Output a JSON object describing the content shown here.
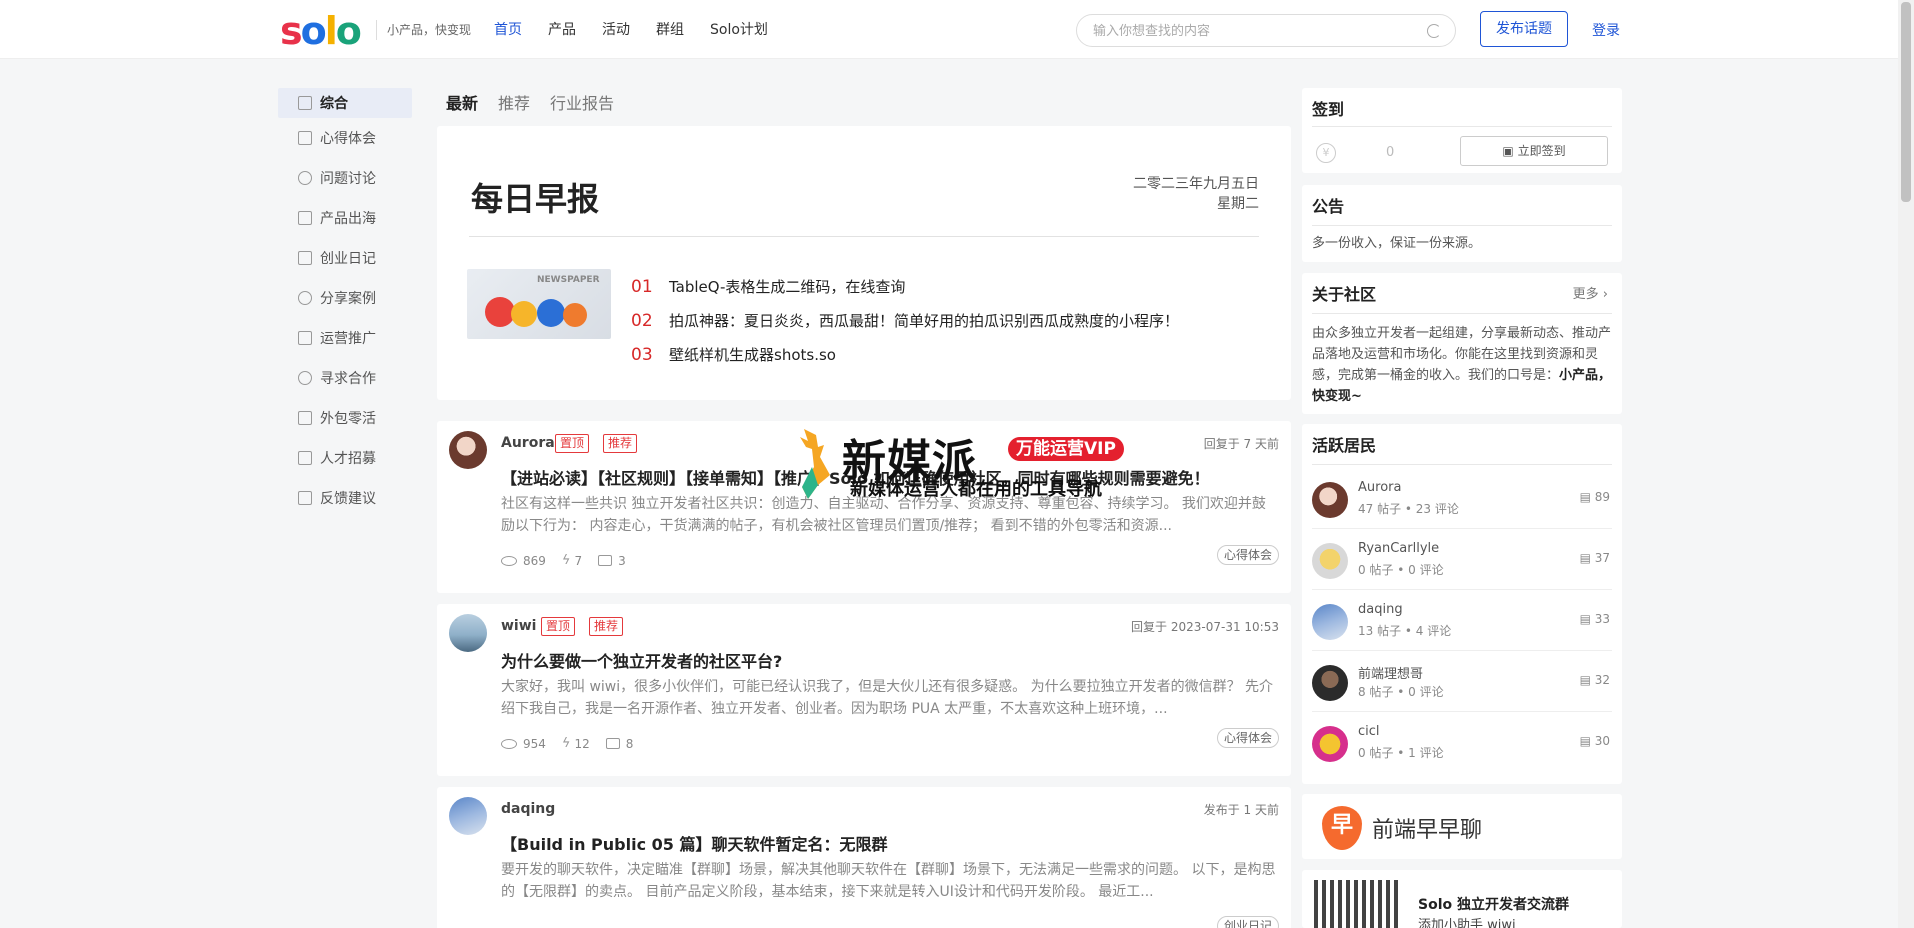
{
  "header": {
    "logo_text": "solo",
    "slogan": "小产品，快变现",
    "nav": [
      "首页",
      "产品",
      "活动",
      "群组",
      "Solo计划"
    ],
    "search_placeholder": "输入你想查找的内容",
    "publish_label": "发布话题",
    "login_label": "登录"
  },
  "sidebar": {
    "items": [
      {
        "label": "综合",
        "active": true
      },
      {
        "label": "心得体会"
      },
      {
        "label": "问题讨论"
      },
      {
        "label": "产品出海"
      },
      {
        "label": "创业日记"
      },
      {
        "label": "分享案例"
      },
      {
        "label": "运营推广"
      },
      {
        "label": "寻求合作"
      },
      {
        "label": "外包零活"
      },
      {
        "label": "人才招募"
      },
      {
        "label": "反馈建议"
      }
    ]
  },
  "tabs": [
    "最新",
    "推荐",
    "行业报告"
  ],
  "daily": {
    "title": "每日早报",
    "date": "二零二三年九月五日",
    "weekday": "星期二",
    "image_text": "NEWSPAPER",
    "items": [
      {
        "num": "01",
        "text": "TableQ-表格生成二维码，在线查询"
      },
      {
        "num": "02",
        "text": "拍瓜神器：夏日炎炎，西瓜最甜！简单好用的拍瓜识别西瓜成熟度的小程序！"
      },
      {
        "num": "03",
        "text": "壁纸样机生成器shots.so"
      }
    ]
  },
  "posts": [
    {
      "author": "Aurora",
      "badges": [
        "置顶",
        "推荐"
      ],
      "time": "回复于 7 天前",
      "title": "【进站必读】【社区规则】【接单需知】【推广】Solo 如何正确使用社区，同时有哪些规则需要避免！",
      "excerpt": "社区有这样一些共识 独立开发者社区共识：创造力、自主驱动、合作分享、资源支持、尊重包容、持续学习。 我们欢迎并鼓励以下行为： 内容走心，干货满满的帖子，有机会被社区管理员们置顶/推荐； 看到不错的外包零活和资源...",
      "views": "869",
      "likes": "7",
      "comments": "3",
      "tag": "心得体会"
    },
    {
      "author": "wiwi",
      "badges": [
        "置顶",
        "推荐"
      ],
      "time": "回复于 2023-07-31 10:53",
      "title": "为什么要做一个独立开发者的社区平台?",
      "excerpt": "大家好，我叫 wiwi，很多小伙伴们，可能已经认识我了，但是大伙儿还有很多疑惑。 为什么要拉独立开发者的微信群？ 先介绍下我自己，我是一名开源作者、独立开发者、创业者。因为职场 PUA 太严重，不太喜欢这种上班环境，...",
      "views": "954",
      "likes": "12",
      "comments": "8",
      "tag": "心得体会"
    },
    {
      "author": "daqing",
      "badges": [],
      "time": "发布于 1 天前",
      "title": "【Build in Public 05 篇】聊天软件暂定名：无限群",
      "excerpt": "要开发的聊天软件，决定瞄准【群聊】场景，解决其他聊天软件在【群聊】场景下，无法满足一些需求的问题。 以下，是构思的【无限群】的卖点。 目前产品定义阶段，基本结束，接下来就是转入UI设计和代码开发阶段。 最近工...",
      "views": "",
      "likes": "",
      "comments": "",
      "tag": "创业日记"
    }
  ],
  "right": {
    "checkin": {
      "title": "签到",
      "coins": "0",
      "button": "立即签到"
    },
    "notice": {
      "title": "公告",
      "text": "多一份收入，保证一份来源。"
    },
    "about": {
      "title": "关于社区",
      "more": "更多",
      "text": "由众多独立开发者一起组建，分享最新动态、推动产品落地及运营和市场化。你能在这里找到资源和灵感，完成第一桶金的收入。我们的口号是：",
      "slogan": "小产品，快变现~"
    },
    "active": {
      "title": "活跃居民",
      "users": [
        {
          "name": "Aurora",
          "meta": "47 帖子 • 23 评论",
          "score": "89"
        },
        {
          "name": "RyanCarllyle",
          "meta": "0 帖子 • 0 评论",
          "score": "37"
        },
        {
          "name": "daqing",
          "meta": "13 帖子 • 4 评论",
          "score": "33"
        },
        {
          "name": "前端理想哥",
          "meta": "8 帖子 • 0 评论",
          "score": "32"
        },
        {
          "name": "cicl",
          "meta": "0 帖子 • 1 评论",
          "score": "30"
        }
      ]
    },
    "banner": {
      "icon": "早",
      "text": "前端早早聊"
    },
    "qr": {
      "title": "Solo 独立开发者交流群",
      "sub": "添加小助手 wiwi"
    }
  },
  "overlay": {
    "main": "新媒派",
    "vip": "万能运营VIP",
    "sub": "新媒体运营人都在用的工具导航"
  },
  "colors": {
    "accent": "#1f55d6",
    "red": "#e4393c",
    "bg": "#f5f6f7"
  }
}
